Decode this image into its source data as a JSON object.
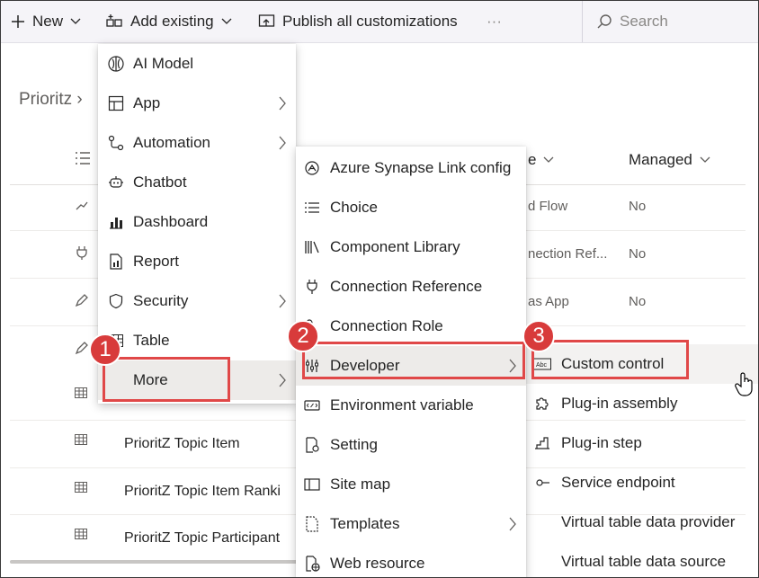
{
  "toolbar": {
    "new_label": "New",
    "add_existing_label": "Add existing",
    "publish_label": "Publish all customizations",
    "overflow_label": "···",
    "search_placeholder": "Search"
  },
  "page": {
    "breadcrumb": "Prioritz",
    "columns": {
      "type": "e",
      "managed": "Managed"
    },
    "rows": [
      {
        "type": "d Flow",
        "managed": "No"
      },
      {
        "type": "nection Ref...",
        "managed": "No"
      },
      {
        "type": "as App",
        "managed": "No"
      }
    ],
    "table_rows": [
      "PrioritZ Topic Item",
      "PrioritZ Topic Item Ranki",
      "PrioritZ Topic Participant"
    ]
  },
  "menu1": {
    "items": [
      {
        "label": "AI Model",
        "icon": "ai-model-icon"
      },
      {
        "label": "App",
        "icon": "app-icon"
      },
      {
        "label": "Automation",
        "icon": "automation-icon"
      },
      {
        "label": "Chatbot",
        "icon": "chatbot-icon"
      },
      {
        "label": "Dashboard",
        "icon": "dashboard-icon"
      },
      {
        "label": "Report",
        "icon": "report-icon"
      },
      {
        "label": "Security",
        "icon": "shield-icon"
      },
      {
        "label": "Table",
        "icon": "table-icon"
      },
      {
        "label": "More",
        "icon": "more-icon"
      }
    ]
  },
  "menu2": {
    "items": [
      {
        "label": "Azure Synapse Link config",
        "icon": "synapse-icon"
      },
      {
        "label": "Choice",
        "icon": "choice-icon"
      },
      {
        "label": "Component Library",
        "icon": "library-icon"
      },
      {
        "label": "Connection Reference",
        "icon": "plug-icon"
      },
      {
        "label": "Connection Role",
        "icon": "connection-role-icon"
      },
      {
        "label": "Developer",
        "icon": "developer-icon"
      },
      {
        "label": "Environment variable",
        "icon": "variable-icon"
      },
      {
        "label": "Setting",
        "icon": "setting-icon"
      },
      {
        "label": "Site map",
        "icon": "sitemap-icon"
      },
      {
        "label": "Templates",
        "icon": "template-icon"
      },
      {
        "label": "Web resource",
        "icon": "web-resource-icon"
      }
    ]
  },
  "menu3": {
    "items": [
      {
        "label": "Custom control",
        "icon": "custom-control-icon"
      },
      {
        "label": "Plug-in assembly",
        "icon": "puzzle-icon"
      },
      {
        "label": "Plug-in step",
        "icon": "plugin-step-icon"
      },
      {
        "label": "Service endpoint",
        "icon": "endpoint-icon"
      },
      {
        "label": "Virtual table data provider",
        "icon": ""
      },
      {
        "label": "Virtual table data source",
        "icon": ""
      }
    ]
  },
  "callouts": {
    "one": "1",
    "two": "2",
    "three": "3"
  },
  "colors": {
    "callout": "#d83b3b",
    "toolbar_bg": "#f5f4f8"
  }
}
